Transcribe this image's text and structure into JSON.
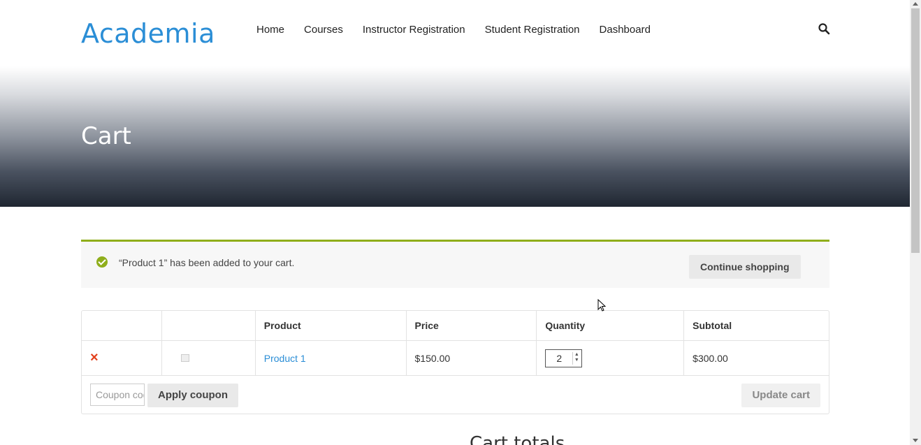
{
  "header": {
    "logo": "Academia",
    "nav": [
      "Home",
      "Courses",
      "Instructor Registration",
      "Student Registration",
      "Dashboard"
    ],
    "search_icon": "search-icon"
  },
  "hero": {
    "title": "Cart"
  },
  "notice": {
    "message": "“Product 1” has been added to your cart.",
    "button": "Continue shopping",
    "accent": "#8fae1b"
  },
  "cart": {
    "headers": [
      "",
      "",
      "Product",
      "Price",
      "Quantity",
      "Subtotal"
    ],
    "rows": [
      {
        "product": "Product 1",
        "price": "$150.00",
        "quantity": "2",
        "subtotal": "$300.00"
      }
    ],
    "coupon_placeholder": "Coupon code",
    "apply_coupon": "Apply coupon",
    "update_cart": "Update cart"
  },
  "totals": {
    "title": "Cart totals"
  },
  "colors": {
    "link": "#2b8ed6",
    "remove": "#e2401c"
  }
}
